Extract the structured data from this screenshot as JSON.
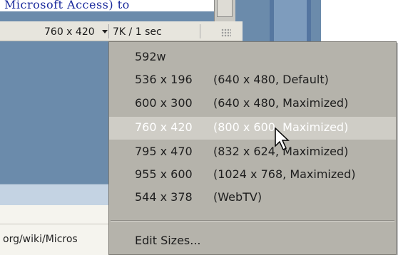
{
  "document": {
    "snippet": "Microsoft Access) to",
    "url_fragment": "org/wiki/Micros"
  },
  "status_bar": {
    "window_size": "760 x 420",
    "download_stats": "7K / 1 sec"
  },
  "window_size_menu": {
    "items": [
      {
        "dim": "592w",
        "desc": ""
      },
      {
        "dim": "536 x 196",
        "desc": "(640 x 480, Default)"
      },
      {
        "dim": "600 x 300",
        "desc": "(640 x 480, Maximized)"
      },
      {
        "dim": "760 x 420",
        "desc": "(800 x 600, Maximized)",
        "highlighted": true
      },
      {
        "dim": "795 x 470",
        "desc": "(832 x 624, Maximized)"
      },
      {
        "dim": "955 x 600",
        "desc": "(1024 x 768, Maximized)"
      },
      {
        "dim": "544 x 378",
        "desc": "(WebTV)"
      }
    ],
    "edit_sizes_label": "Edit Sizes..."
  },
  "colors": {
    "menu_bg": "#b5b3ab",
    "menu_highlight": "#cfcdc6",
    "highlight_text": "#ffffff",
    "doc_bg": "#6b8bab"
  },
  "icons": {
    "file_icon": "dreamweaver-file-icon",
    "cursor": "mouse-pointer-icon"
  }
}
